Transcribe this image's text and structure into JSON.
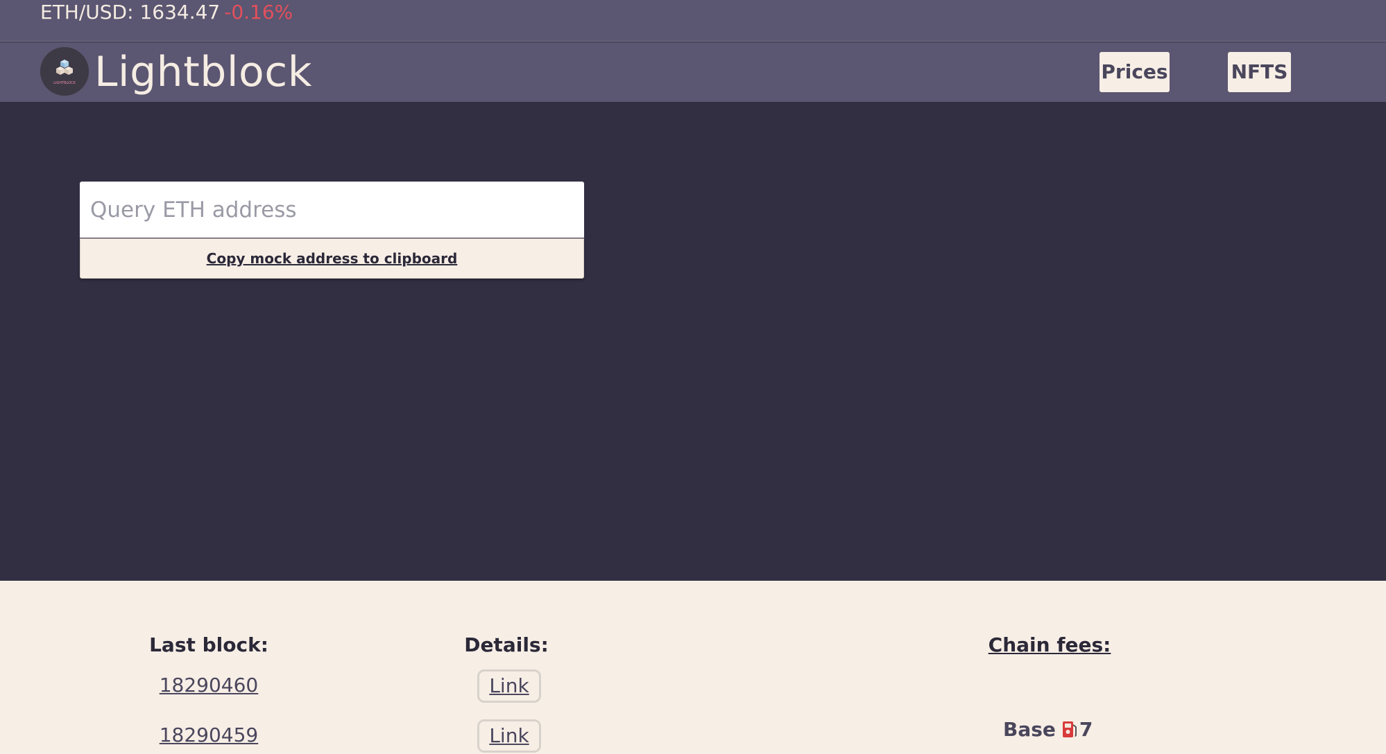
{
  "ticker": {
    "pair_price": "ETH/USD: 1634.47",
    "change": "-0.16%",
    "change_color": "#e2505c"
  },
  "header": {
    "brand": "Lightblock",
    "logo_text": "LIGHTBLOCK",
    "nav": {
      "prices": "Prices",
      "nfts": "NFTS"
    }
  },
  "search": {
    "placeholder": "Query ETH address",
    "value": "",
    "copy_button": "Copy mock address to clipboard"
  },
  "footer": {
    "last_block_heading": "Last block:",
    "details_heading": "Details:",
    "chain_fees_heading": "Chain fees:",
    "blocks": [
      {
        "number": "18290460",
        "details": "Link"
      },
      {
        "number": "18290459",
        "details": "Link"
      }
    ],
    "fees": {
      "base_label": "Base",
      "base_icon": "fuel-pump-icon",
      "base_value": "7"
    }
  },
  "colors": {
    "header_bg": "#5b5671",
    "body_bg": "#332f43",
    "cream": "#f7eee6",
    "text_dark": "#2b2838"
  }
}
